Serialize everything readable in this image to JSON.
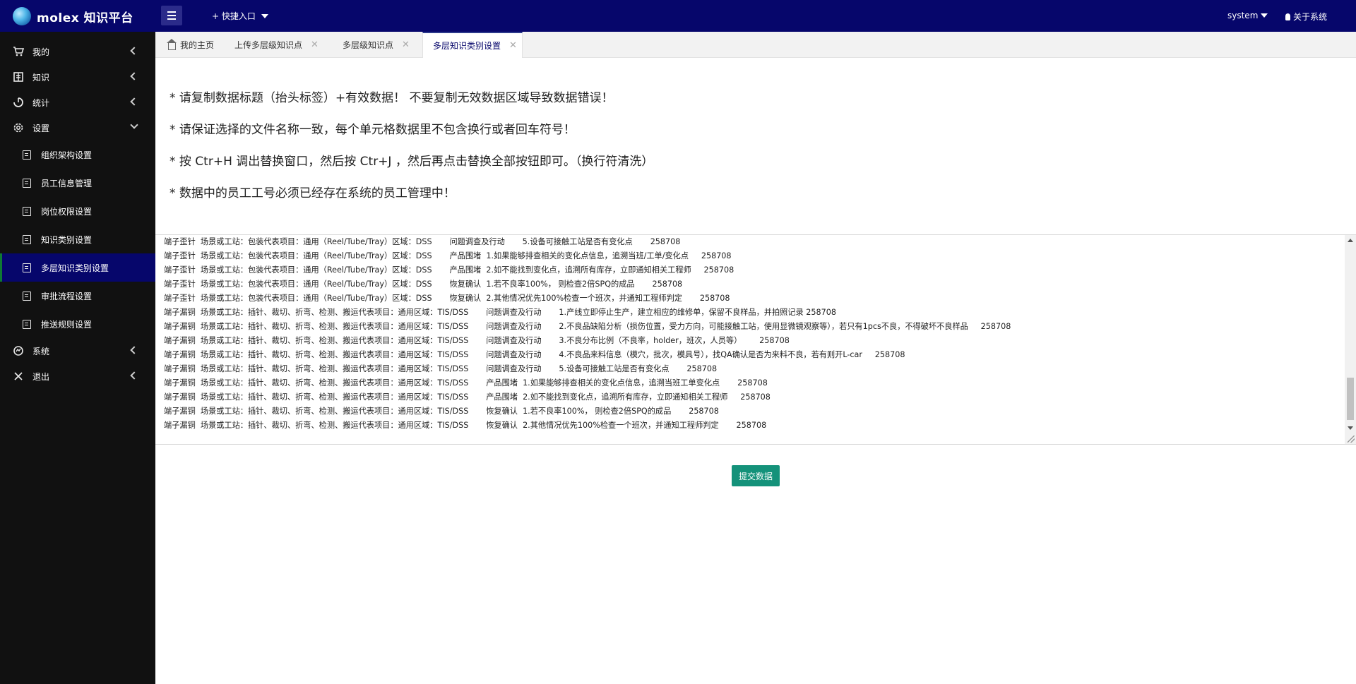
{
  "app": {
    "title": "molex 知识平台"
  },
  "topbar": {
    "quick_entry": "+ 快捷入口",
    "user": "system",
    "about": "关于系统"
  },
  "sidebar": {
    "items": [
      {
        "label": "我的",
        "icon": "cart-icon"
      },
      {
        "label": "知识",
        "icon": "book-icon"
      },
      {
        "label": "统计",
        "icon": "chart-icon"
      },
      {
        "label": "设置",
        "icon": "gear-icon"
      }
    ],
    "sub_items": [
      {
        "label": "组织架构设置"
      },
      {
        "label": "员工信息管理"
      },
      {
        "label": "岗位权限设置"
      },
      {
        "label": "知识类别设置"
      },
      {
        "label": "多层知识类别设置"
      },
      {
        "label": "审批流程设置"
      },
      {
        "label": "推送规则设置"
      }
    ],
    "bottom_items": [
      {
        "label": "系统",
        "icon": "system-icon"
      },
      {
        "label": "退出",
        "icon": "close-icon"
      }
    ]
  },
  "tabs": [
    {
      "label": "我的主页"
    },
    {
      "label": "上传多层级知识点"
    },
    {
      "label": "多层级知识点"
    },
    {
      "label": "多层知识类别设置"
    }
  ],
  "instructions": [
    "* 请复制数据标题（抬头标签）+有效数据！  不要复制无效数据区域导致数据错误！",
    "* 请保证选择的文件名称一致，每个单元格数据里不包含换行或者回车符号！",
    "* 按 Ctr+H 调出替换窗口，然后按 Ctr+J ，然后再点击替换全部按钮即可。（换行符清洗）",
    "* 数据中的员工工号必须已经存在系统的员工管理中！"
  ],
  "textarea_lines": [
    "端子歪针  场景或工站：包装代表项目：通用（Reel/Tube/Tray）区域：DSS       问题调查及行动       5.设备可接触工站是否有变化点       258708",
    "端子歪针  场景或工站：包装代表项目：通用（Reel/Tube/Tray）区域：DSS       产品围堵  1.如果能够排查相关的变化点信息，追溯当班/工单/变化点     258708",
    "端子歪针  场景或工站：包装代表项目：通用（Reel/Tube/Tray）区域：DSS       产品围堵  2.如不能找到变化点，追溯所有库存，立即通知相关工程师     258708",
    "端子歪针  场景或工站：包装代表项目：通用（Reel/Tube/Tray）区域：DSS       恢复确认  1.若不良率100%， 则检查2倍SPQ的成品       258708",
    "端子歪针  场景或工站：包装代表项目：通用（Reel/Tube/Tray）区域：DSS       恢复确认  2.其他情况优先100%检查一个班次，并通知工程师判定       258708",
    "端子漏铜  场景或工站：插针、裁切、折弯、检测、搬运代表项目：通用区域：TIS/DSS       问题调查及行动       1.产线立即停止生产，建立相应的维修单，保留不良样品，并拍照记录 258708",
    "端子漏铜  场景或工站：插针、裁切、折弯、检测、搬运代表项目：通用区域：TIS/DSS       问题调查及行动       2.不良品缺陷分析（损伤位置，受力方向，可能接触工站，使用显微镜观察等），若只有1pcs不良，不得破坏不良样品     258708",
    "端子漏铜  场景或工站：插针、裁切、折弯、检测、搬运代表项目：通用区域：TIS/DSS       问题调查及行动       3.不良分布比例（不良率，holder，班次，人员等）       258708",
    "端子漏铜  场景或工站：插针、裁切、折弯、检测、搬运代表项目：通用区域：TIS/DSS       问题调查及行动       4.不良品来料信息（模穴，批次，模具号），找QA确认是否为来料不良，若有则开L-car     258708",
    "端子漏铜  场景或工站：插针、裁切、折弯、检测、搬运代表项目：通用区域：TIS/DSS       问题调查及行动       5.设备可接触工站是否有变化点       258708",
    "端子漏铜  场景或工站：插针、裁切、折弯、检测、搬运代表项目：通用区域：TIS/DSS       产品围堵  1.如果能够排查相关的变化点信息，追溯当班工单变化点       258708",
    "端子漏铜  场景或工站：插针、裁切、折弯、检测、搬运代表项目：通用区域：TIS/DSS       产品围堵  2.如不能找到变化点，追溯所有库存，立即通知相关工程师     258708",
    "端子漏铜  场景或工站：插针、裁切、折弯、检测、搬运代表项目：通用区域：TIS/DSS       恢复确认  1.若不良率100%， 则检查2倍SPQ的成品       258708",
    "端子漏铜  场景或工站：插针、裁切、折弯、检测、搬运代表项目：通用区域：TIS/DSS       恢复确认  2.其他情况优先100%检查一个班次，并通知工程师判定       258708"
  ],
  "submit_label": "提交数据",
  "colors": {
    "topbar": "#06066b",
    "sidebar": "#111111",
    "active_sub": "#06066b",
    "submit": "#14927a"
  }
}
